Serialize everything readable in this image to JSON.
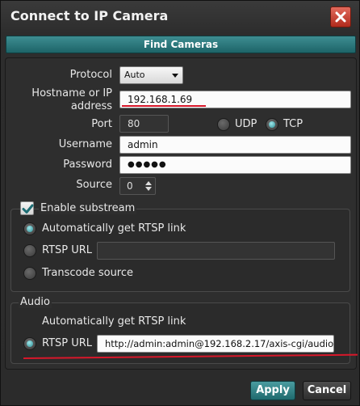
{
  "window": {
    "title": "Connect to IP Camera"
  },
  "toolbar": {
    "find_cameras_label": "Find Cameras"
  },
  "form": {
    "protocol": {
      "label": "Protocol",
      "value": "Auto"
    },
    "hostname": {
      "label_line1": "Hostname or IP",
      "label_line2": "address",
      "value": "192.168.1.69"
    },
    "port": {
      "label": "Port",
      "value": "80"
    },
    "transport": {
      "udp_label": "UDP",
      "tcp_label": "TCP",
      "selected": "TCP"
    },
    "username": {
      "label": "Username",
      "value": "admin"
    },
    "password": {
      "label": "Password",
      "value": "●●●●●"
    },
    "source": {
      "label": "Source",
      "value": "0"
    }
  },
  "substream": {
    "enable_label": "Enable substream",
    "enabled": true,
    "options": {
      "auto_label": "Automatically get RTSP link",
      "rtsp_label": "RTSP URL",
      "transcode_label": "Transcode source"
    },
    "selected": "auto",
    "rtsp_url": ""
  },
  "audio": {
    "group_label": "Audio",
    "auto_label": "Automatically get RTSP link",
    "rtsp_label": "RTSP URL",
    "rtsp_url": "http://admin:admin@192.168.2.17/axis-cgi/audio/",
    "selected": "rtsp"
  },
  "buttons": {
    "apply_label": "Apply",
    "cancel_label": "Cancel"
  },
  "colors": {
    "accent": "#2c8f95",
    "annotation_red": "#d8172a",
    "close_red": "#c43a2b"
  }
}
